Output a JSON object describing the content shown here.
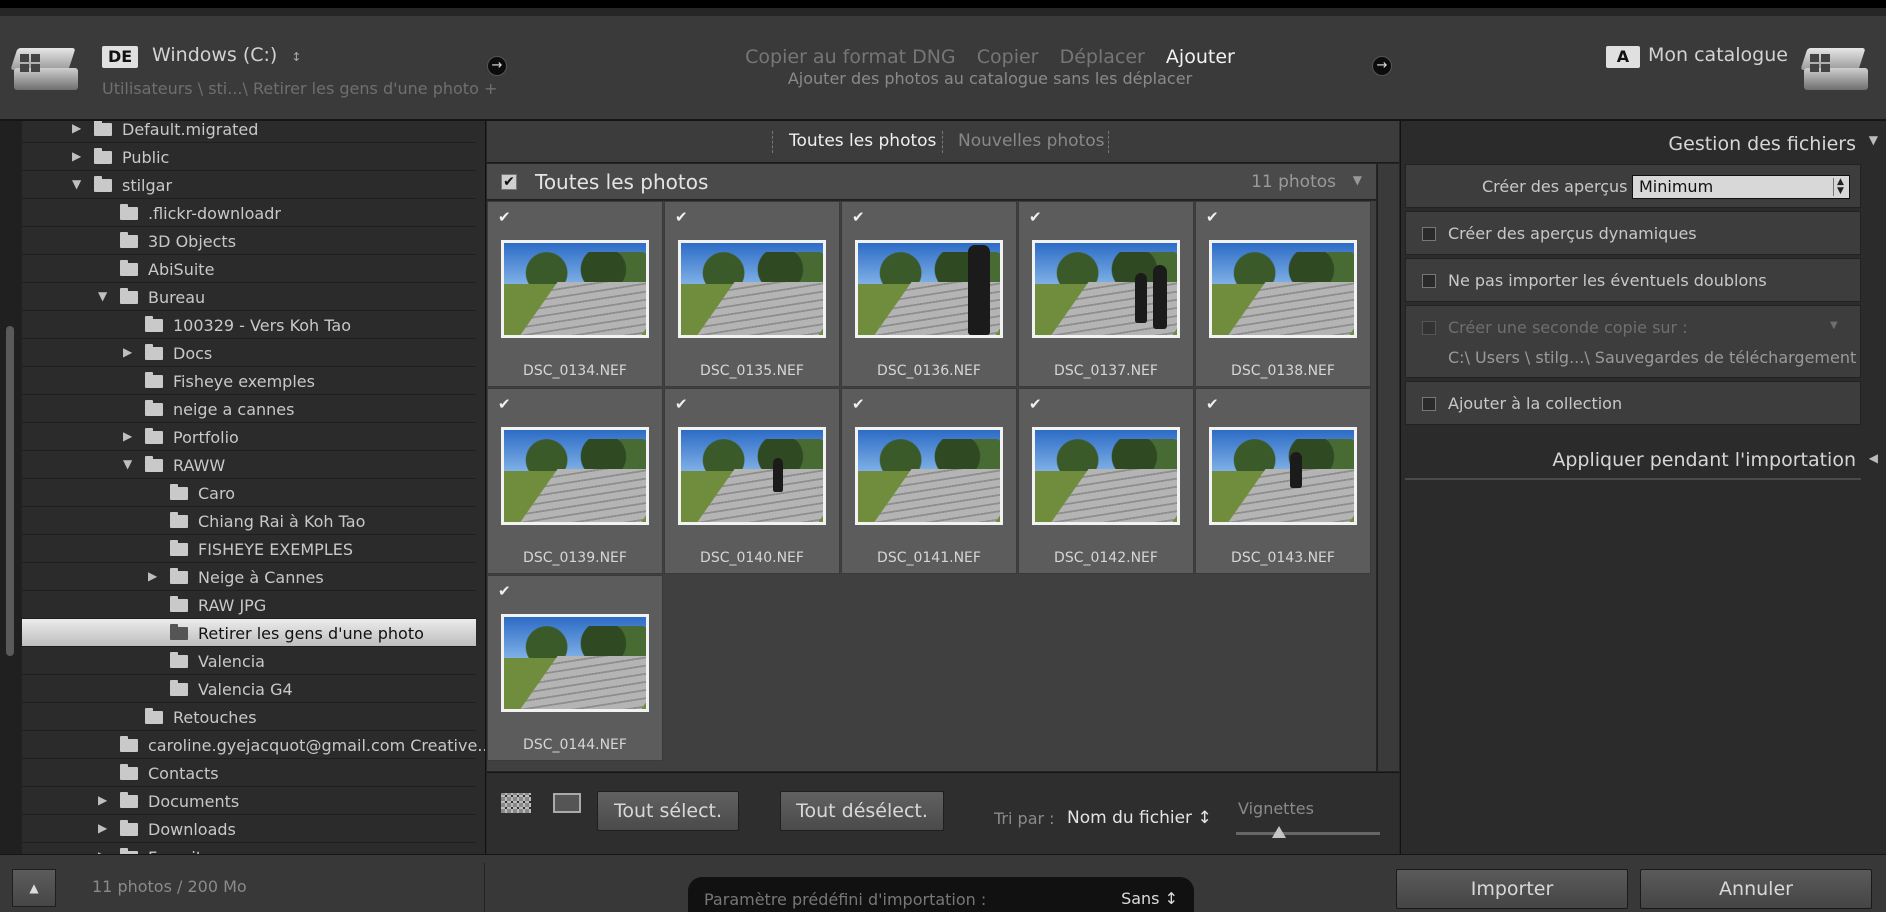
{
  "header": {
    "source": {
      "badge": "DE",
      "drive": "Windows (C:)",
      "drive_spin": "↕",
      "path": "Utilisateurs \\ sti...\\ Retirer les gens d'une photo +"
    },
    "modes": [
      "Copier au format DNG",
      "Copier",
      "Déplacer",
      "Ajouter"
    ],
    "active_mode": "Ajouter",
    "mode_description": "Ajouter des photos au catalogue sans les déplacer",
    "dest": {
      "badge": "A",
      "catalog": "Mon catalogue"
    },
    "arrow": "→"
  },
  "tree": [
    {
      "label": "Default.migrated",
      "depth": 0,
      "arrow": "▶"
    },
    {
      "label": "Public",
      "depth": 0,
      "arrow": "▶"
    },
    {
      "label": "stilgar",
      "depth": 0,
      "arrow": "▼"
    },
    {
      "label": ".flickr-downloadr",
      "depth": 1,
      "arrow": ""
    },
    {
      "label": "3D Objects",
      "depth": 1,
      "arrow": ""
    },
    {
      "label": "AbiSuite",
      "depth": 1,
      "arrow": ""
    },
    {
      "label": "Bureau",
      "depth": 1,
      "arrow": "▼"
    },
    {
      "label": "100329 - Vers Koh Tao",
      "depth": 2,
      "arrow": ""
    },
    {
      "label": "Docs",
      "depth": 2,
      "arrow": "▶"
    },
    {
      "label": "Fisheye exemples",
      "depth": 2,
      "arrow": ""
    },
    {
      "label": "neige a cannes",
      "depth": 2,
      "arrow": ""
    },
    {
      "label": "Portfolio",
      "depth": 2,
      "arrow": "▶"
    },
    {
      "label": "RAWW",
      "depth": 2,
      "arrow": "▼"
    },
    {
      "label": "Caro",
      "depth": 3,
      "arrow": ""
    },
    {
      "label": "Chiang Rai à Koh Tao",
      "depth": 3,
      "arrow": ""
    },
    {
      "label": "FISHEYE EXEMPLES",
      "depth": 3,
      "arrow": ""
    },
    {
      "label": "Neige à Cannes",
      "depth": 3,
      "arrow": "▶"
    },
    {
      "label": "RAW JPG",
      "depth": 3,
      "arrow": ""
    },
    {
      "label": "Retirer les gens d'une photo",
      "depth": 3,
      "arrow": "",
      "selected": true
    },
    {
      "label": "Valencia",
      "depth": 3,
      "arrow": ""
    },
    {
      "label": "Valencia G4",
      "depth": 3,
      "arrow": ""
    },
    {
      "label": "Retouches",
      "depth": 2,
      "arrow": ""
    },
    {
      "label": "caroline.gyejacquot@gmail.com Creative...",
      "depth": 1,
      "arrow": ""
    },
    {
      "label": "Contacts",
      "depth": 1,
      "arrow": ""
    },
    {
      "label": "Documents",
      "depth": 1,
      "arrow": "▶"
    },
    {
      "label": "Downloads",
      "depth": 1,
      "arrow": "▶"
    },
    {
      "label": "Favorites",
      "depth": 1,
      "arrow": "▶"
    }
  ],
  "center": {
    "tabs": [
      "Toutes les photos",
      "Nouvelles photos"
    ],
    "grid_title": "Toutes les photos",
    "grid_count": "11 photos",
    "check": "✔",
    "menu_tri": "▼",
    "photos": [
      {
        "name": "DSC_0134.NEF",
        "people": []
      },
      {
        "name": "DSC_0135.NEF",
        "people": []
      },
      {
        "name": "DSC_0136.NEF",
        "people": [
          "big"
        ]
      },
      {
        "name": "DSC_0137.NEF",
        "people": [
          "mid",
          "mid2"
        ]
      },
      {
        "name": "DSC_0138.NEF",
        "people": []
      },
      {
        "name": "DSC_0139.NEF",
        "people": []
      },
      {
        "name": "DSC_0140.NEF",
        "people": [
          "small"
        ]
      },
      {
        "name": "DSC_0141.NEF",
        "people": []
      },
      {
        "name": "DSC_0142.NEF",
        "people": []
      },
      {
        "name": "DSC_0143.NEF",
        "people": [
          "small2"
        ]
      },
      {
        "name": "DSC_0144.NEF",
        "people": []
      }
    ],
    "toolbar": {
      "select_all": "Tout sélect.",
      "deselect_all": "Tout désélect.",
      "sort_label": "Tri par :",
      "sort_value": "Nom du fichier ↕",
      "thumbs_label": "Vignettes",
      "thumb_size": 0.3
    }
  },
  "right": {
    "file_handling": {
      "title": "Gestion des fichiers",
      "previews_label": "Créer des aperçus",
      "previews_value": "Minimum",
      "smart_previews": "Créer des aperçus dynamiques",
      "no_duplicates": "Ne pas importer les éventuels doublons",
      "second_copy": "Créer une seconde copie sur :",
      "second_copy_path": "C:\\ Users \\ stilg...\\ Sauvegardes de téléchargement",
      "add_collection": "Ajouter à la collection"
    },
    "apply_during_import": "Appliquer pendant l'importation",
    "tri_down": "▼",
    "tri_left": "◀"
  },
  "footer": {
    "up_arrow": "▲",
    "info": "11 photos / 200 Mo",
    "preset_label": "Paramètre prédéfini d'importation :",
    "preset_value": "Sans ↕",
    "import": "Importer",
    "cancel": "Annuler"
  }
}
